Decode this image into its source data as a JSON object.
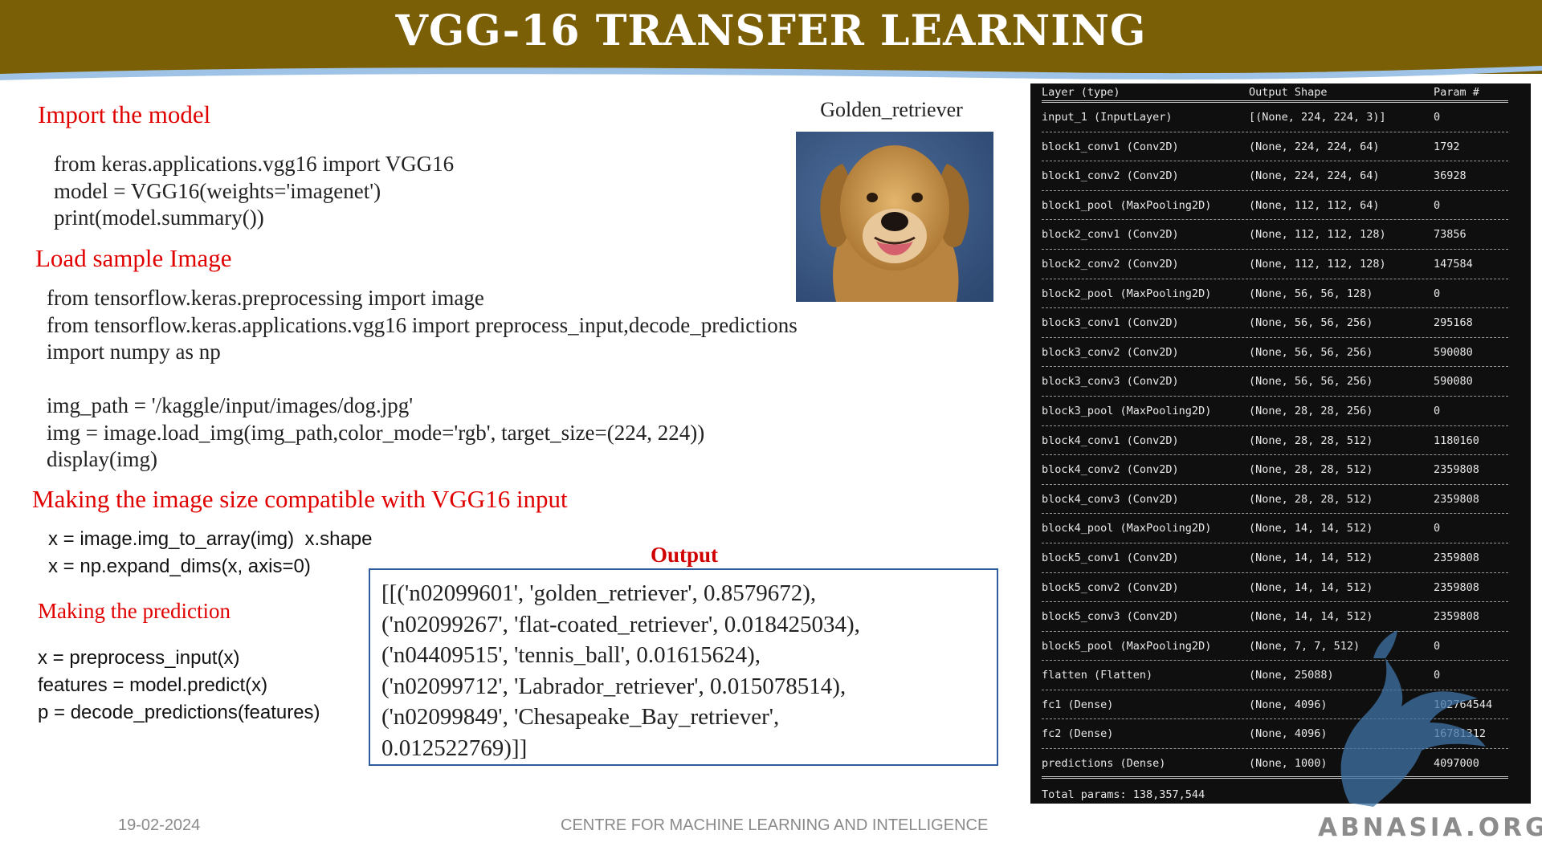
{
  "header": {
    "title": "VGG-16 TRANSFER LEARNING"
  },
  "sections": {
    "import_model": {
      "heading": "Import the model",
      "code": [
        "from keras.applications.vgg16 import VGG16",
        "model = VGG16(weights='imagenet')",
        "print(model.summary())"
      ]
    },
    "load_image": {
      "heading": "Load sample Image",
      "code": [
        "from tensorflow.keras.preprocessing import image",
        "from tensorflow.keras.applications.vgg16 import preprocess_input,decode_predictions",
        "import numpy as np",
        "",
        "img_path = '/kaggle/input/images/dog.jpg'",
        "img = image.load_img(img_path,color_mode='rgb', target_size=(224, 224))",
        "display(img)"
      ]
    },
    "resize": {
      "heading": "Making the image size compatible with VGG16 input",
      "code": [
        "x = image.img_to_array(img)  x.shape",
        "x = np.expand_dims(x, axis=0)"
      ]
    },
    "predict": {
      "heading": "Making the prediction",
      "code": [
        "x = preprocess_input(x)",
        "features = model.predict(x)",
        "p = decode_predictions(features)"
      ]
    }
  },
  "image": {
    "caption": "Golden_retriever"
  },
  "output": {
    "title": "Output",
    "lines": [
      "[[('n02099601', 'golden_retriever', 0.8579672),",
      "('n02099267', 'flat-coated_retriever', 0.018425034),",
      "('n04409515', 'tennis_ball', 0.01615624),",
      "('n02099712', 'Labrador_retriever', 0.015078514),",
      "('n02099849', 'Chesapeake_Bay_retriever',",
      "0.012522769)]]"
    ]
  },
  "model_summary": {
    "headers": [
      "Layer (type)",
      "Output Shape",
      "Param #"
    ],
    "rows": [
      [
        "input_1 (InputLayer)",
        "[(None, 224, 224, 3)]",
        "0"
      ],
      [
        "block1_conv1 (Conv2D)",
        "(None, 224, 224, 64)",
        "1792"
      ],
      [
        "block1_conv2 (Conv2D)",
        "(None, 224, 224, 64)",
        "36928"
      ],
      [
        "block1_pool (MaxPooling2D)",
        "(None, 112, 112, 64)",
        "0"
      ],
      [
        "block2_conv1 (Conv2D)",
        "(None, 112, 112, 128)",
        "73856"
      ],
      [
        "block2_conv2 (Conv2D)",
        "(None, 112, 112, 128)",
        "147584"
      ],
      [
        "block2_pool (MaxPooling2D)",
        "(None, 56, 56, 128)",
        "0"
      ],
      [
        "block3_conv1 (Conv2D)",
        "(None, 56, 56, 256)",
        "295168"
      ],
      [
        "block3_conv2 (Conv2D)",
        "(None, 56, 56, 256)",
        "590080"
      ],
      [
        "block3_conv3 (Conv2D)",
        "(None, 56, 56, 256)",
        "590080"
      ],
      [
        "block3_pool (MaxPooling2D)",
        "(None, 28, 28, 256)",
        "0"
      ],
      [
        "block4_conv1 (Conv2D)",
        "(None, 28, 28, 512)",
        "1180160"
      ],
      [
        "block4_conv2 (Conv2D)",
        "(None, 28, 28, 512)",
        "2359808"
      ],
      [
        "block4_conv3 (Conv2D)",
        "(None, 28, 28, 512)",
        "2359808"
      ],
      [
        "block4_pool (MaxPooling2D)",
        "(None, 14, 14, 512)",
        "0"
      ],
      [
        "block5_conv1 (Conv2D)",
        "(None, 14, 14, 512)",
        "2359808"
      ],
      [
        "block5_conv2 (Conv2D)",
        "(None, 14, 14, 512)",
        "2359808"
      ],
      [
        "block5_conv3 (Conv2D)",
        "(None, 14, 14, 512)",
        "2359808"
      ],
      [
        "block5_pool (MaxPooling2D)",
        "(None, 7, 7, 512)",
        "0"
      ],
      [
        "flatten (Flatten)",
        "(None, 25088)",
        "0"
      ],
      [
        "fc1 (Dense)",
        "(None, 4096)",
        "102764544"
      ],
      [
        "fc2 (Dense)",
        "(None, 4096)",
        "16781312"
      ],
      [
        "predictions (Dense)",
        "(None, 1000)",
        "4097000"
      ]
    ],
    "total": "Total params: 138,357,544"
  },
  "footer": {
    "date": "19-02-2024",
    "center": "CENTRE FOR MACHINE LEARNING AND INTELLIGENCE",
    "brand": "ABNASIA.ORG"
  },
  "colors": {
    "header_bg": "#7a5f06",
    "heading_red": "#e00000",
    "output_border": "#2e5d9f",
    "summary_bg": "#0f0f0f"
  }
}
